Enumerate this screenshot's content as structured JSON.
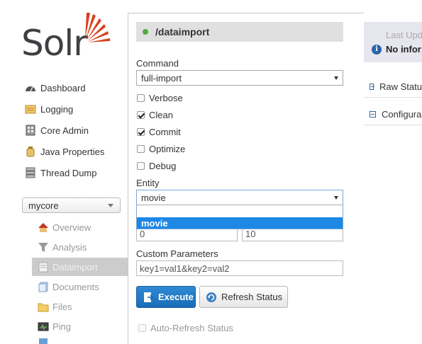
{
  "logo": {
    "text": "Solr"
  },
  "sidebar": {
    "items": [
      {
        "label": "Dashboard",
        "icon": "dashboard-icon"
      },
      {
        "label": "Logging",
        "icon": "logging-icon"
      },
      {
        "label": "Core Admin",
        "icon": "core-admin-icon"
      },
      {
        "label": "Java Properties",
        "icon": "java-properties-icon"
      },
      {
        "label": "Thread Dump",
        "icon": "thread-dump-icon"
      }
    ],
    "core_selector": {
      "value": "mycore"
    },
    "core_items": [
      {
        "label": "Overview",
        "icon": "overview-icon"
      },
      {
        "label": "Analysis",
        "icon": "analysis-icon"
      },
      {
        "label": "Dataimport",
        "icon": "dataimport-icon",
        "active": true
      },
      {
        "label": "Documents",
        "icon": "documents-icon"
      },
      {
        "label": "Files",
        "icon": "files-icon"
      },
      {
        "label": "Ping",
        "icon": "ping-icon"
      }
    ]
  },
  "main": {
    "handler_title": "/dataimport",
    "status_color": "#4cae3b",
    "command_label": "Command",
    "command_value": "full-import",
    "checkboxes": [
      {
        "label": "Verbose",
        "checked": false
      },
      {
        "label": "Clean",
        "checked": true
      },
      {
        "label": "Commit",
        "checked": true
      },
      {
        "label": "Optimize",
        "checked": false
      },
      {
        "label": "Debug",
        "checked": false
      }
    ],
    "entity_label": "Entity",
    "entity_value": "movie",
    "entity_options": [
      "",
      "movie"
    ],
    "start_value": "0",
    "rows_value": "10",
    "custom_params_label": "Custom Parameters",
    "custom_params_value": "key1=val1&key2=val2",
    "execute_label": "Execute",
    "refresh_label": "Refresh Status",
    "auto_refresh_label": "Auto-Refresh Status",
    "accent_color": "#1e88e5"
  },
  "right": {
    "last_update_label": "Last Upd",
    "no_info_text": "No infor",
    "raw_status_label": "Raw Statu",
    "configuration_label": "Configura"
  }
}
